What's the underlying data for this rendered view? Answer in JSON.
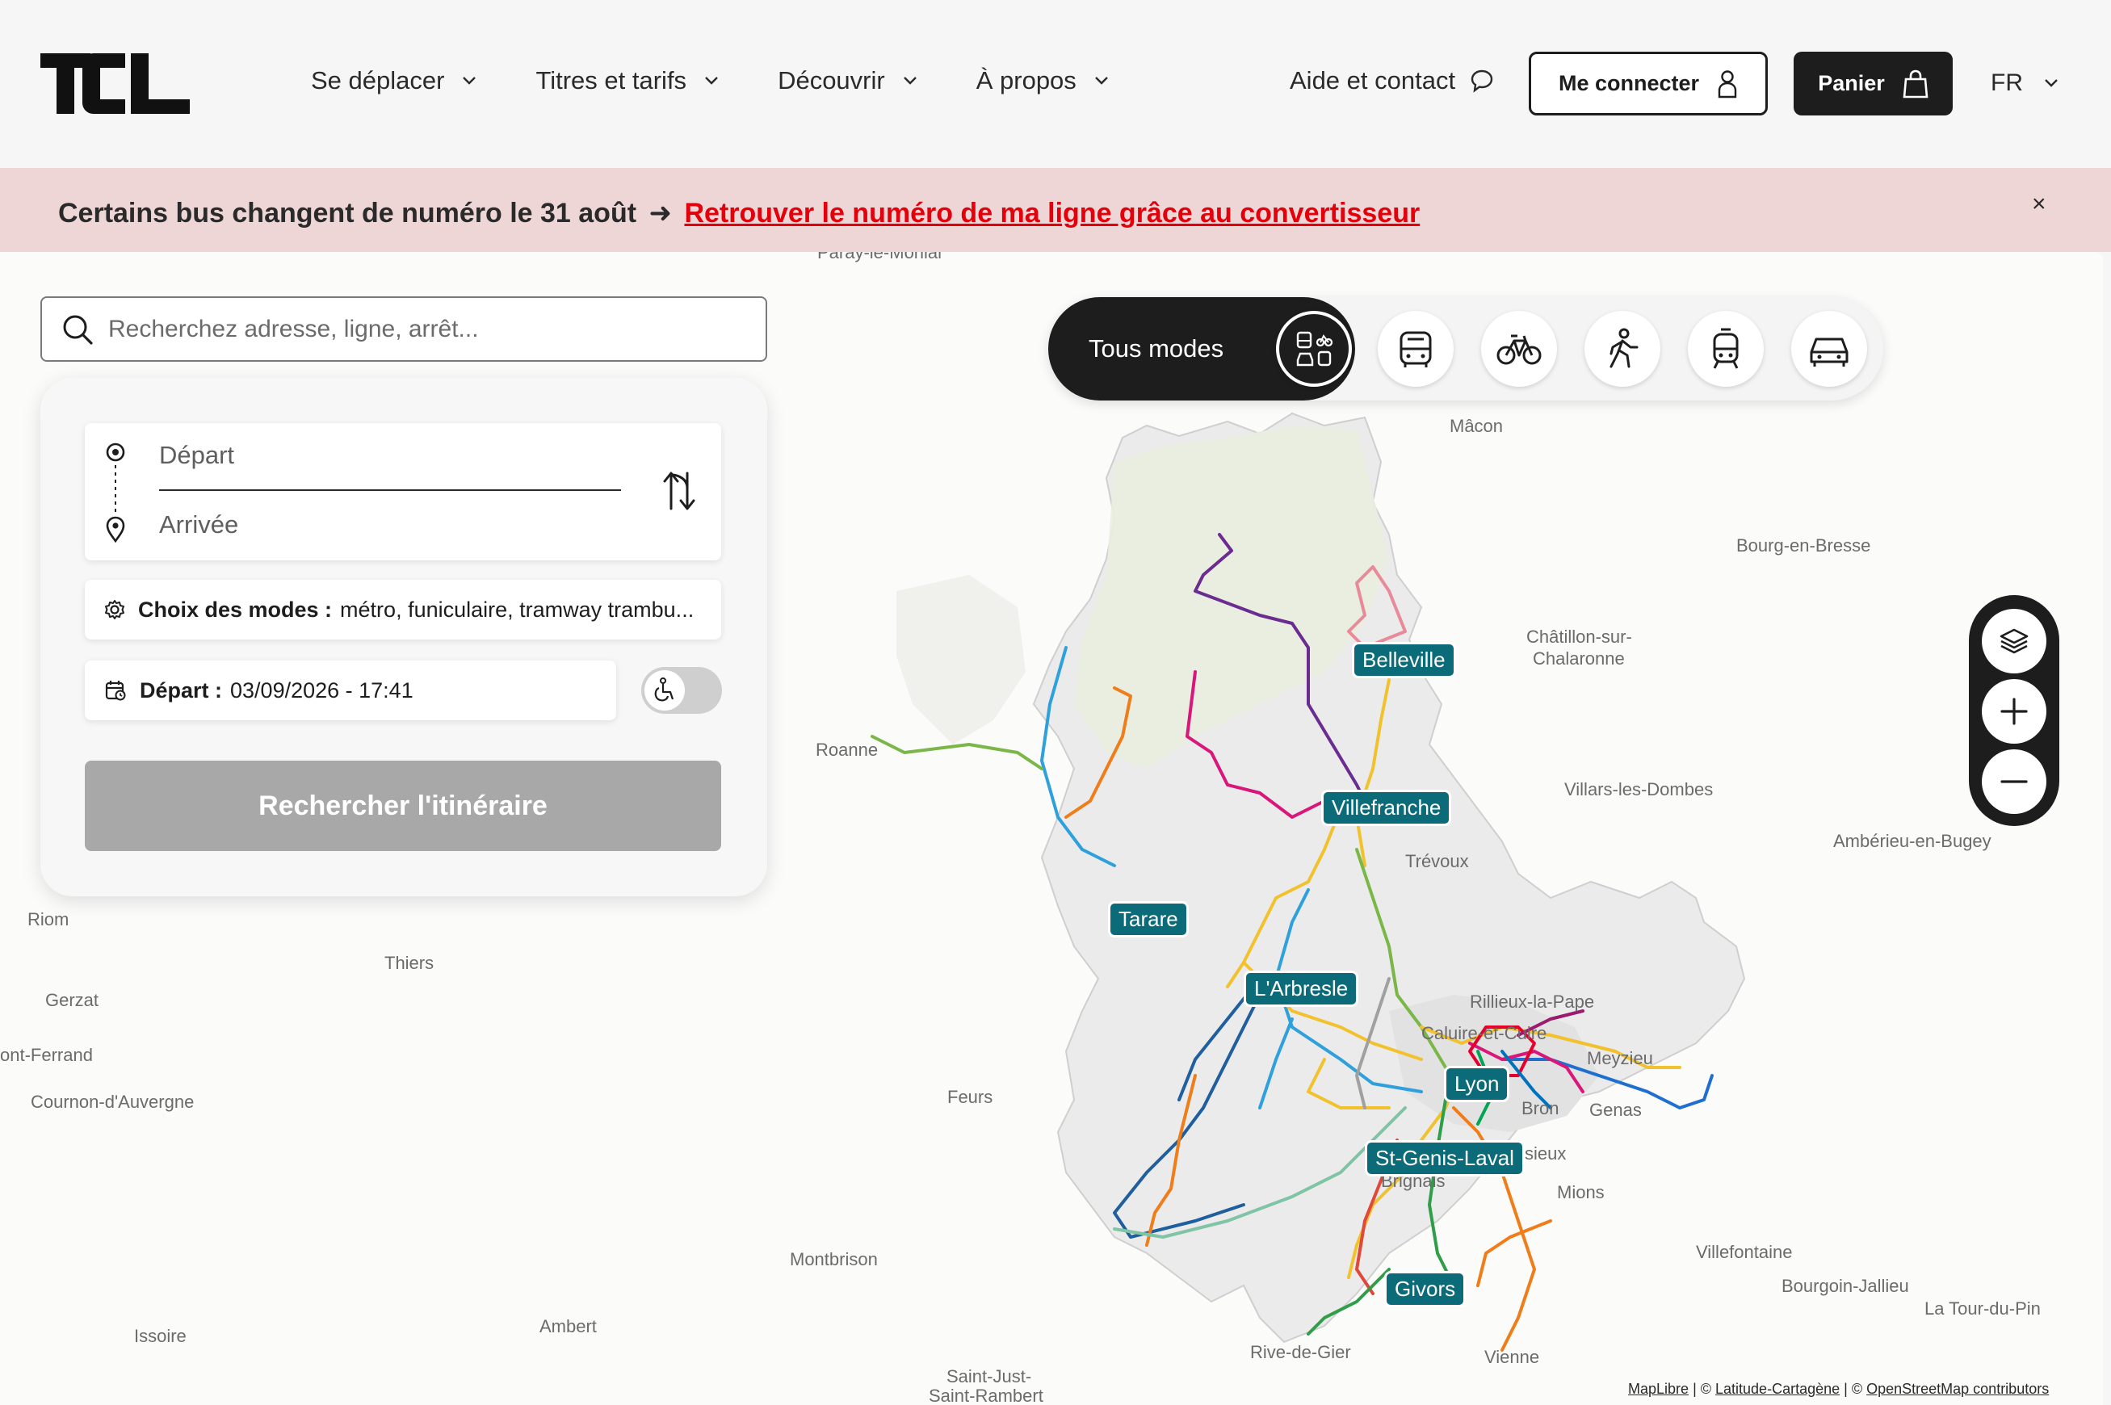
{
  "header": {
    "logo_text": "TCL",
    "nav": [
      {
        "label": "Se déplacer"
      },
      {
        "label": "Titres et tarifs"
      },
      {
        "label": "Découvrir"
      },
      {
        "label": "À propos"
      }
    ],
    "help_label": "Aide et contact",
    "login_label": "Me connecter",
    "cart_label": "Panier",
    "language": "FR"
  },
  "banner": {
    "text": "Certains bus changent de numéro le 31 août",
    "arrow": "➜",
    "link": "Retrouver le numéro de ma ligne grâce au convertisseur",
    "close": "×"
  },
  "search": {
    "placeholder": "Recherchez adresse, ligne, arrêt..."
  },
  "planner": {
    "departure_placeholder": "Départ",
    "arrival_placeholder": "Arrivée",
    "modes_label": "Choix des modes :",
    "modes_value": "métro, funiculaire, tramway trambu...",
    "date_label": "Départ :",
    "date_value": "03/09/2026 - 17:41",
    "accessibility_toggle": false,
    "search_button": "Rechercher l'itinéraire"
  },
  "modebar": {
    "all_label": "Tous modes",
    "modes": [
      "multimodal-icon",
      "bus-icon",
      "bike-icon",
      "walk-icon",
      "tram-icon",
      "car-icon"
    ],
    "selected": "multimodal-icon"
  },
  "map": {
    "places": [
      "Paray-le-Monial",
      "Mâcon",
      "Bourg-en-Bresse",
      "Châtillon-sur-",
      "Chalaronne",
      "Roanne",
      "Villars-les-Dombes",
      "Trévoux",
      "Ambérieu-en-Bugey",
      "Riom",
      "Thiers",
      "Gerzat",
      "ont-Ferrand",
      "Cournon-d'Auvergne",
      "Rillieux-la-Pape",
      "Caluire-et-Cuire",
      "Meyzieu",
      "Feurs",
      "Bron",
      "Genas",
      "sieux",
      "Brignais",
      "Mions",
      "Montbrison",
      "Villefontaine",
      "Bourgoin-Jallieu",
      "La Tour-du-Pin",
      "Issoire",
      "Ambert",
      "Rive-de-Gier",
      "Vienne",
      "Saint-Just-",
      "Saint-Rambert"
    ],
    "cities": [
      "Belleville",
      "Villefranche",
      "Tarare",
      "L'Arbresle",
      "Lyon",
      "St-Genis-Laval",
      "Givors"
    ],
    "attribution": [
      "MapLibre",
      "Latitude-Cartagène",
      "OpenStreetMap contributors"
    ]
  },
  "colors": {
    "brand_dark": "#1d1d1d",
    "alert_red": "#e3000b",
    "banner_bg": "#eed6d6",
    "city_pill": "#0b6b78"
  }
}
